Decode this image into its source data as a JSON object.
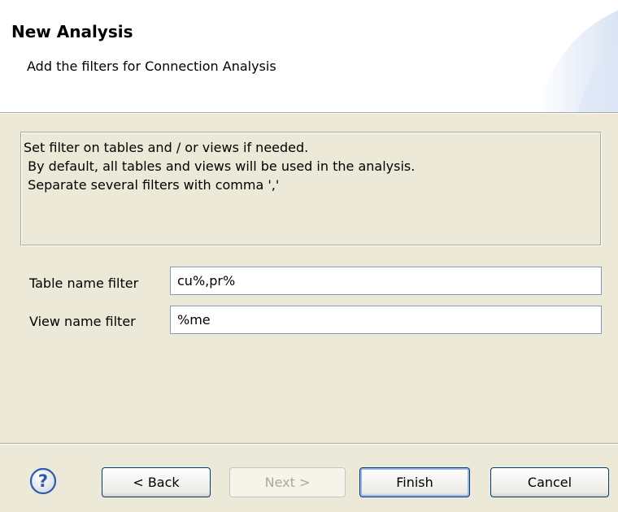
{
  "header": {
    "title": "New Analysis",
    "subtitle": "Add the filters for Connection Analysis"
  },
  "info": {
    "text": "Set filter on tables and / or views if needed.\n By default, all tables and views will be used in the analysis.\n Separate several filters with comma ','"
  },
  "fields": {
    "table_filter": {
      "label": "Table name filter",
      "value": "cu%,pr%"
    },
    "view_filter": {
      "label": "View name filter",
      "value": "%me"
    }
  },
  "buttons": {
    "back": "< Back",
    "next": "Next >",
    "finish": "Finish",
    "cancel": "Cancel",
    "help_icon": "question-mark-circle-icon"
  },
  "colors": {
    "dialog_background": "#ece9d8",
    "header_background": "#ffffff",
    "button_border": "#003c74",
    "help_icon": "#2f5aa8"
  }
}
